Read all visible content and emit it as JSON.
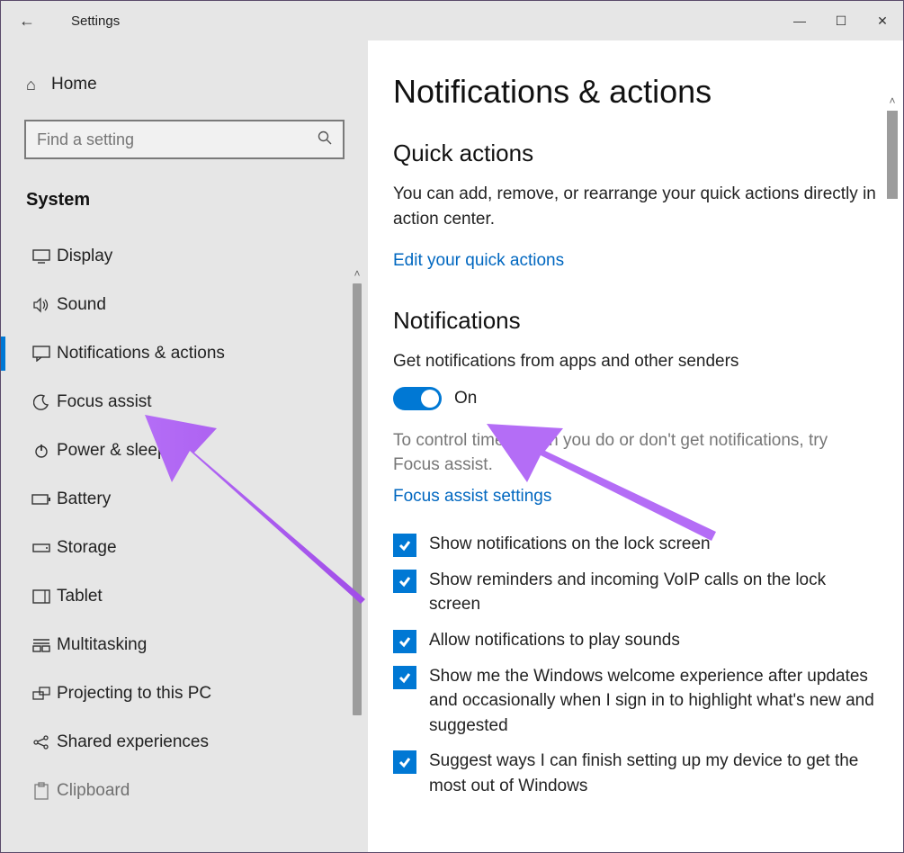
{
  "window": {
    "title": "Settings"
  },
  "home": {
    "label": "Home"
  },
  "search": {
    "placeholder": "Find a setting"
  },
  "section": {
    "title": "System"
  },
  "nav": [
    {
      "id": "display",
      "label": "Display",
      "icon": "monitor"
    },
    {
      "id": "sound",
      "label": "Sound",
      "icon": "speaker"
    },
    {
      "id": "notifications",
      "label": "Notifications & actions",
      "icon": "chat",
      "selected": true
    },
    {
      "id": "focus-assist",
      "label": "Focus assist",
      "icon": "moon"
    },
    {
      "id": "power-sleep",
      "label": "Power & sleep",
      "icon": "power"
    },
    {
      "id": "battery",
      "label": "Battery",
      "icon": "battery"
    },
    {
      "id": "storage",
      "label": "Storage",
      "icon": "storage"
    },
    {
      "id": "tablet",
      "label": "Tablet",
      "icon": "tablet"
    },
    {
      "id": "multitasking",
      "label": "Multitasking",
      "icon": "multitask"
    },
    {
      "id": "projecting",
      "label": "Projecting to this PC",
      "icon": "project"
    },
    {
      "id": "shared",
      "label": "Shared experiences",
      "icon": "share"
    },
    {
      "id": "clipboard",
      "label": "Clipboard",
      "icon": "clipboard"
    }
  ],
  "page": {
    "heading": "Notifications & actions",
    "quick": {
      "title": "Quick actions",
      "desc": "You can add, remove, or rearrange your quick actions directly in action center.",
      "link": "Edit your quick actions"
    },
    "notifications": {
      "title": "Notifications",
      "toggle_label": "Get notifications from apps and other senders",
      "toggle_state": "On",
      "hint": "To control times when you do or don't get notifications, try Focus assist.",
      "focus_link": "Focus assist settings",
      "options": [
        "Show notifications on the lock screen",
        "Show reminders and incoming VoIP calls on the lock screen",
        "Allow notifications to play sounds",
        "Show me the Windows welcome experience after updates and occasionally when I sign in to highlight what's new and suggested",
        "Suggest ways I can finish setting up my device to get the most out of Windows"
      ]
    }
  }
}
